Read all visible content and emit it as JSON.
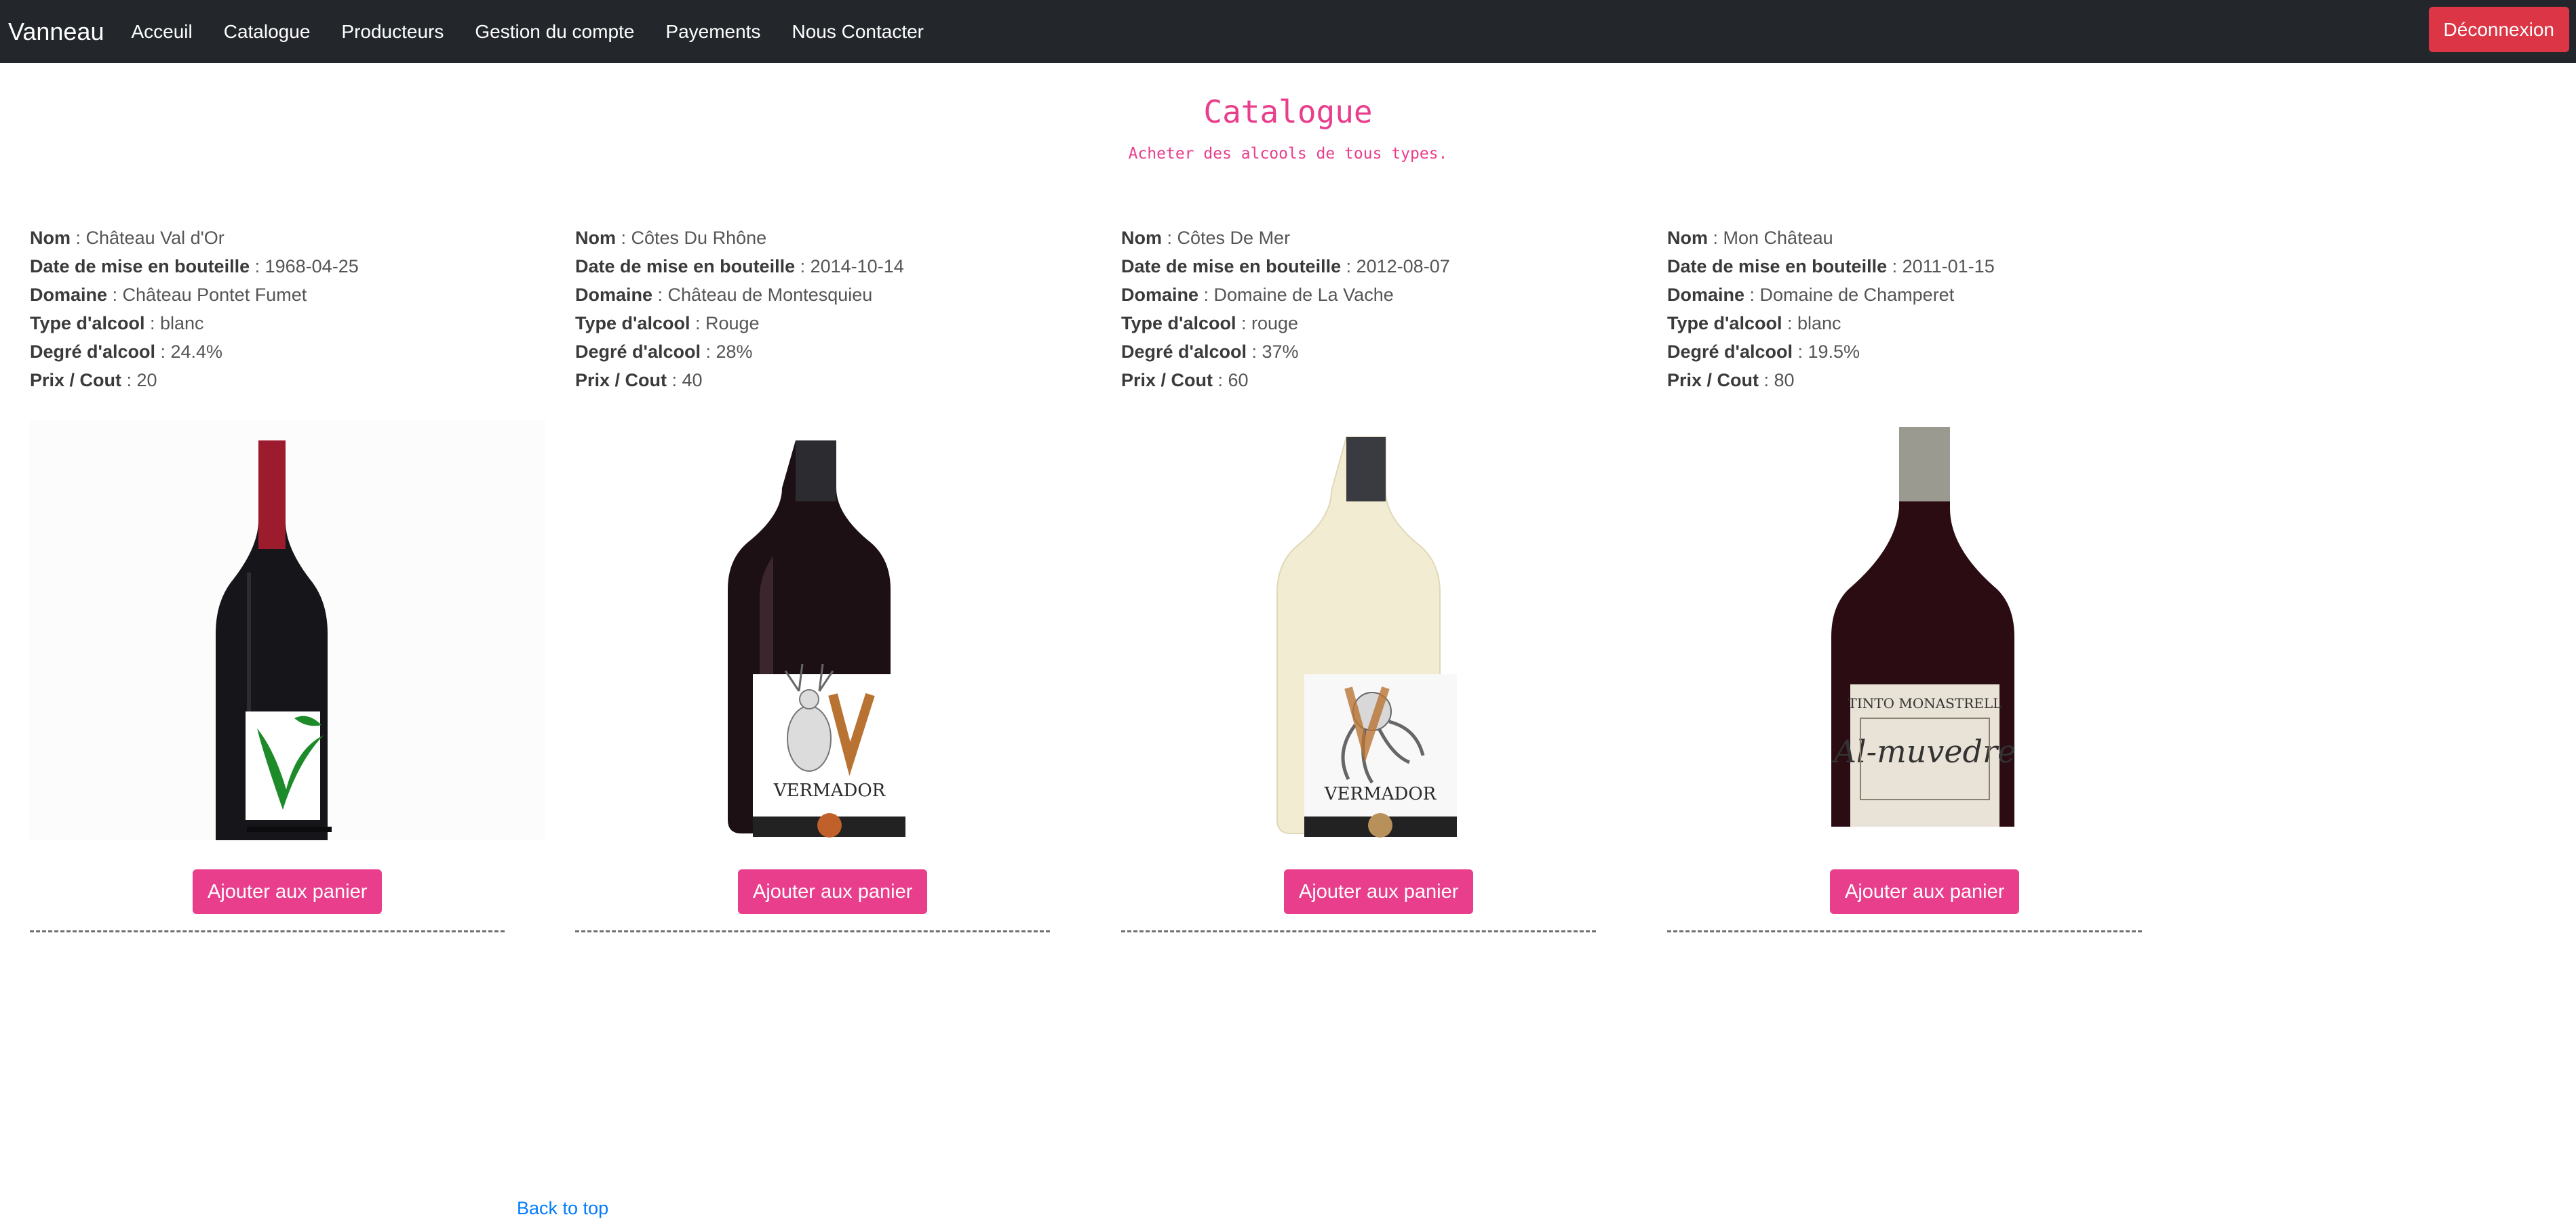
{
  "navbar": {
    "brand": "Vanneau",
    "links": [
      "Acceuil",
      "Catalogue",
      "Producteurs",
      "Gestion du compte",
      "Payements",
      "Nous Contacter"
    ],
    "logout": "Déconnexion"
  },
  "header": {
    "title": "Catalogue",
    "subtitle": "Acheter des alcools de tous types."
  },
  "labels": {
    "nom": "Nom",
    "date": "Date de mise en bouteille",
    "domaine": "Domaine",
    "type": "Type d'alcool",
    "degre": "Degré d'alcool",
    "prix": "Prix / Cout",
    "sep": " : "
  },
  "products": [
    {
      "nom": "Château Val d'Or",
      "date": "1968-04-25",
      "domaine": "Château Pontet Fumet",
      "type": "blanc",
      "degre": "24.4%",
      "prix": "20",
      "button": "Ajouter aux panier"
    },
    {
      "nom": "Côtes Du Rhône",
      "date": "2014-10-14",
      "domaine": "Château de Montesquieu",
      "type": "Rouge",
      "degre": "28%",
      "prix": "40",
      "button": "Ajouter aux panier",
      "label_brand": "VERMADOR"
    },
    {
      "nom": "Côtes De Mer",
      "date": "2012-08-07",
      "domaine": "Domaine de La Vache",
      "type": "rouge",
      "degre": "37%",
      "prix": "60",
      "button": "Ajouter aux panier",
      "label_brand": "VERMADOR"
    },
    {
      "nom": "Mon Château",
      "date": "2011-01-15",
      "domaine": "Domaine de Champeret",
      "type": "blanc",
      "degre": "19.5%",
      "prix": "80",
      "button": "Ajouter aux panier",
      "label_brand": "Al-muvedre",
      "label_top": "TINTO MONASTRELL"
    }
  ],
  "footer": {
    "back_to_top": "Back to top"
  },
  "colors": {
    "navbar": "#23272b",
    "accent_pink": "#e83e8c",
    "logout_red": "#dc3545",
    "link_blue": "#007bff"
  },
  "icons": [
    "vegan-v-icon",
    "deer-icon",
    "octopus-icon"
  ]
}
